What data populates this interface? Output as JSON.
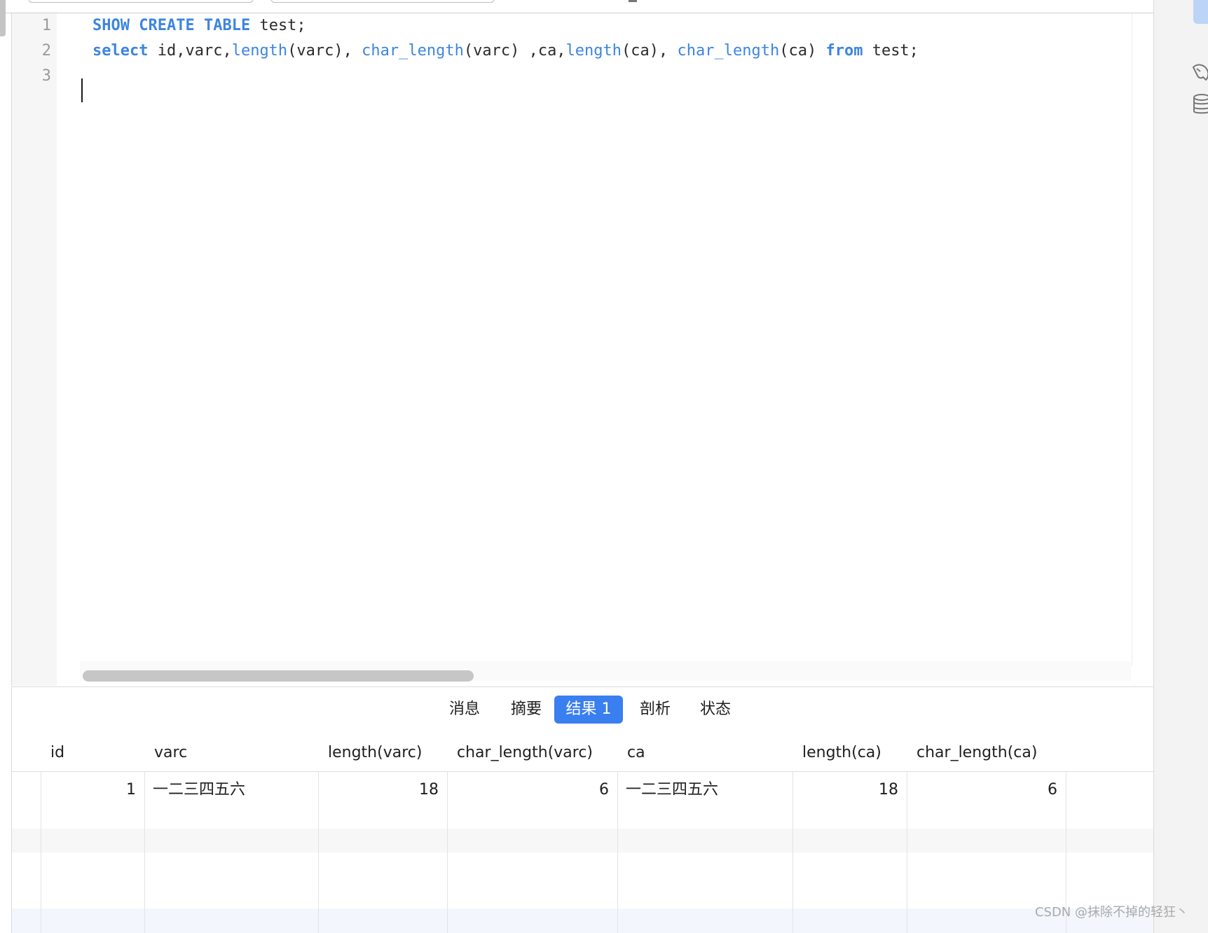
{
  "editor": {
    "line_numbers": [
      "1",
      "2",
      "3"
    ],
    "line1": {
      "kw1": "SHOW",
      "kw2": "CREATE",
      "kw3": "TABLE",
      "rest": " test;"
    },
    "line2": {
      "kw_select": "select",
      "t1": " id,varc,",
      "fn1": "length",
      "t2": "(varc), ",
      "fn2": "char_length",
      "t3": "(varc) ,ca,",
      "fn3": "length",
      "t4": "(ca), ",
      "fn4": "char_length",
      "t5": "(ca) ",
      "kw_from": "from",
      "t6": " test;"
    },
    "line3": ""
  },
  "tabs": [
    {
      "label": "消息"
    },
    {
      "label": "摘要"
    },
    {
      "label": "结果 1",
      "active": true
    },
    {
      "label": "剖析"
    },
    {
      "label": "状态"
    }
  ],
  "results": {
    "columns": [
      "id",
      "varc",
      "length(varc)",
      "char_length(varc)",
      "ca",
      "length(ca)",
      "char_length(ca)"
    ],
    "rows": [
      [
        "1",
        "一二三四五六",
        "18",
        "6",
        "一二三四五六",
        "18",
        "6"
      ]
    ]
  },
  "watermark": "CSDN @抹除不掉的轻狂丶",
  "colors": {
    "keyword": "#3d85e0",
    "active_tab": "#3a7ff0"
  },
  "icons": [
    "mysql-dolphin-icon",
    "database-icon"
  ]
}
